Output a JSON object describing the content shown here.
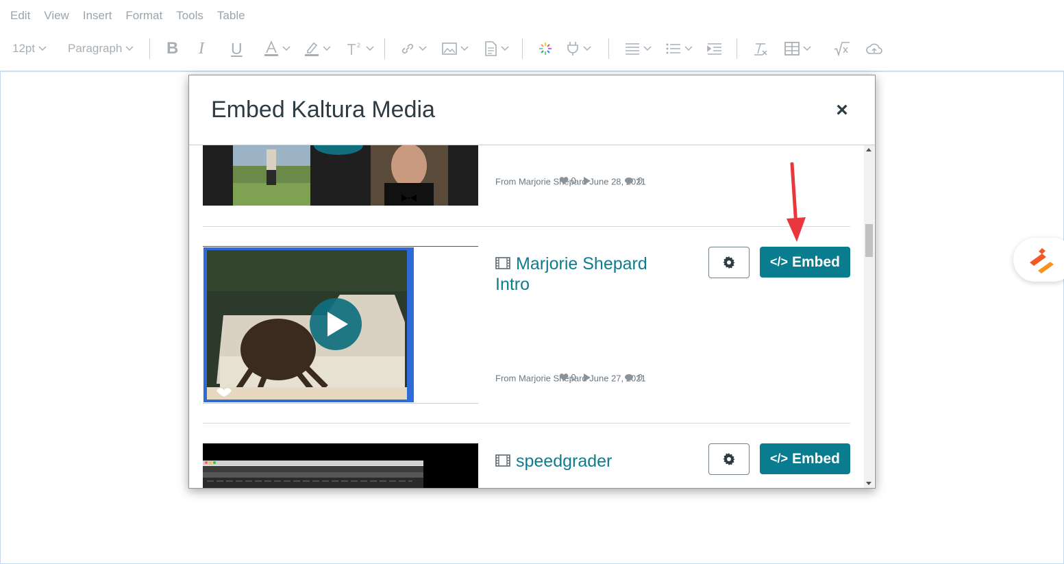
{
  "menu": [
    "Edit",
    "View",
    "Insert",
    "Format",
    "Tools",
    "Table"
  ],
  "toolbar": {
    "font_size": "12pt",
    "block_format": "Paragraph"
  },
  "modal": {
    "title": "Embed Kaltura Media",
    "close_label": "×",
    "entries": [
      {
        "title": "",
        "meta_prefix": "From Marjorie Shepard June 28, 2021",
        "likes": "0",
        "plays": "",
        "comments": "0"
      },
      {
        "title": "Marjorie Shepard Intro",
        "meta_prefix": "From Marjorie Shepard June 27, 2021",
        "likes": "0",
        "plays": "",
        "comments": "0",
        "embed_label": "Embed"
      },
      {
        "title": "speedgrader",
        "embed_label": "Embed"
      }
    ]
  },
  "colors": {
    "accent": "#0a7c8f",
    "link": "#0f7c8e",
    "annotation_arrow": "#e8383d"
  }
}
